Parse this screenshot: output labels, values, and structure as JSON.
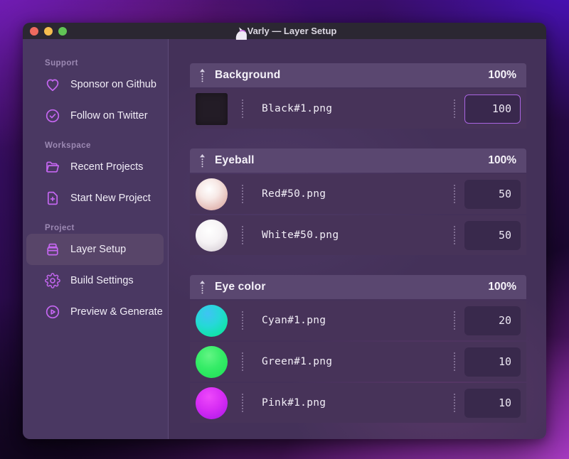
{
  "window": {
    "title": "Varly — Layer Setup"
  },
  "titlebar": {
    "app_icon": "unicorn-icon",
    "traffic_lights": [
      "close",
      "minimize",
      "zoom"
    ]
  },
  "sidebar": {
    "sections": [
      {
        "label": "Support",
        "items": [
          {
            "icon": "heart-icon",
            "label": "Sponsor on Github"
          },
          {
            "icon": "badge-check-icon",
            "label": "Follow on Twitter"
          }
        ]
      },
      {
        "label": "Workspace",
        "items": [
          {
            "icon": "folder-open-icon",
            "label": "Recent Projects"
          },
          {
            "icon": "file-plus-icon",
            "label": "Start New Project"
          }
        ]
      },
      {
        "label": "Project",
        "items": [
          {
            "icon": "archive-box-icon",
            "label": "Layer Setup",
            "active": true
          },
          {
            "icon": "gear-icon",
            "label": "Build Settings"
          },
          {
            "icon": "play-circle-icon",
            "label": "Preview & Generate"
          }
        ]
      }
    ]
  },
  "layers": {
    "groups": [
      {
        "name": "Background",
        "opacity": "100%",
        "rows": [
          {
            "file": "Black#1.png",
            "value": "100",
            "swatch": "black-square",
            "focused": true
          }
        ]
      },
      {
        "name": "Eyeball",
        "opacity": "100%",
        "rows": [
          {
            "file": "Red#50.png",
            "value": "50",
            "swatch": "red-sphere",
            "focused": false
          },
          {
            "file": "White#50.png",
            "value": "50",
            "swatch": "white-sphere",
            "focused": false
          }
        ]
      },
      {
        "name": "Eye color",
        "opacity": "100%",
        "rows": [
          {
            "file": "Cyan#1.png",
            "value": "20",
            "swatch": "cyan-circle",
            "focused": false
          },
          {
            "file": "Green#1.png",
            "value": "10",
            "swatch": "green-circle",
            "focused": false
          },
          {
            "file": "Pink#1.png",
            "value": "10",
            "swatch": "pink-circle",
            "focused": false
          }
        ]
      }
    ]
  },
  "colors": {
    "accent_purple": "#c466f0",
    "focused_input_border": "#a964e0",
    "group_header_bg": "#5a4770",
    "row_bg": "#473359",
    "sidebar_bg": "#4a3862",
    "titlebar_bg": "#2b2732",
    "traffic_red": "#ee6a5f",
    "traffic_yellow": "#f5bd4f",
    "traffic_green": "#61c455",
    "swatch_black": "#231c26",
    "swatch_cyan": "#19ddc2",
    "swatch_green": "#2cea60",
    "swatch_pink": "#cf29f2"
  }
}
